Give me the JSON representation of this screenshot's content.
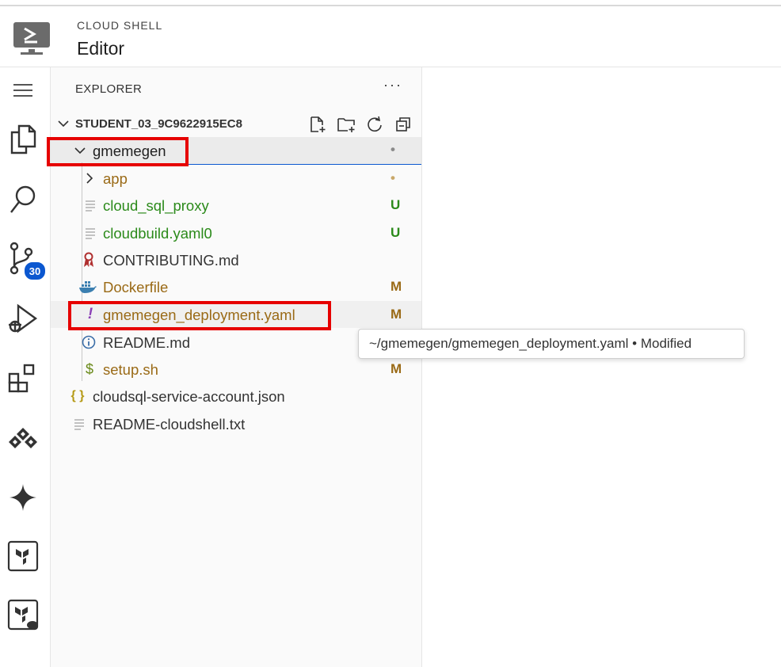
{
  "header": {
    "subtitle": "CLOUD SHELL",
    "title": "Editor"
  },
  "activity_bar": {
    "items": [
      {
        "icon": "menu-icon"
      },
      {
        "icon": "explorer-icon"
      },
      {
        "icon": "search-icon"
      },
      {
        "icon": "source-control-icon",
        "badge": "30"
      },
      {
        "icon": "run-debug-icon"
      },
      {
        "icon": "extensions-icon"
      },
      {
        "icon": "cloud-code-icon"
      },
      {
        "icon": "gemini-sparkle-icon"
      },
      {
        "icon": "terraform-icon"
      },
      {
        "icon": "terraform-cloud-icon"
      }
    ]
  },
  "explorer": {
    "title": "EXPLORER",
    "more": "···",
    "root_label": "STUDENT_03_9C9622915EC8",
    "items": [
      {
        "label": "gmemegen",
        "type": "folder-open",
        "status": "•",
        "color": "#1f1f1f"
      },
      {
        "label": "app",
        "type": "folder",
        "status": "•",
        "color": "#9a6a16"
      },
      {
        "label": "cloud_sql_proxy",
        "type": "file",
        "status": "U",
        "color": "#2b8a1a"
      },
      {
        "label": "cloudbuild.yaml0",
        "type": "file",
        "status": "U",
        "color": "#2b8a1a"
      },
      {
        "label": "CONTRIBUTING.md",
        "type": "ribbon-file",
        "status": "",
        "color": "#333333"
      },
      {
        "label": "Dockerfile",
        "type": "docker-file",
        "status": "M",
        "color": "#9a6a16"
      },
      {
        "label": "gmemegen_deployment.yaml",
        "type": "yaml-file",
        "status": "M",
        "color": "#9a6a16"
      },
      {
        "label": "README.md",
        "type": "info-file",
        "status": "",
        "color": "#333333"
      },
      {
        "label": "setup.sh",
        "type": "shell-file",
        "status": "M",
        "color": "#9a6a16"
      },
      {
        "label": "cloudsql-service-account.json",
        "type": "json-file",
        "status": "",
        "color": "#333333"
      },
      {
        "label": "README-cloudshell.txt",
        "type": "file",
        "status": "",
        "color": "#333333"
      }
    ]
  },
  "tooltip": {
    "text": "~/gmemegen/gmemegen_deployment.yaml • Modified"
  },
  "colors": {
    "untracked": "#2b8a1a",
    "modified": "#9a6a16",
    "highlight": "#e60000",
    "accent": "#0b57d0"
  }
}
